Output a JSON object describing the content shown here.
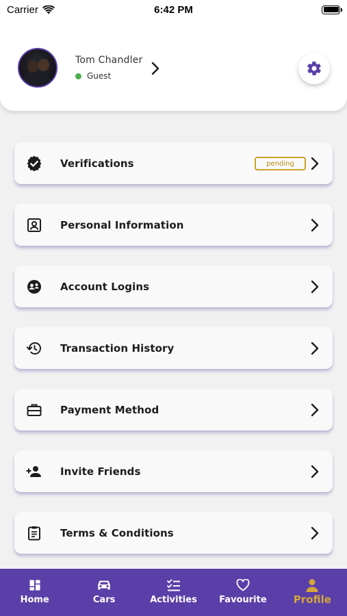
{
  "status_bar": {
    "carrier": "Carrier",
    "time": "6:42 PM"
  },
  "profile": {
    "name": "Tom Chandler",
    "role": "Guest",
    "status_color": "#4caf50"
  },
  "menu": {
    "items": [
      {
        "label": "Verifications",
        "icon": "verified-badge-icon",
        "badge": "pending"
      },
      {
        "label": "Personal Information",
        "icon": "id-card-icon"
      },
      {
        "label": "Account Logins",
        "icon": "logins-icon"
      },
      {
        "label": "Transaction History",
        "icon": "history-icon"
      },
      {
        "label": "Payment Method",
        "icon": "briefcase-icon"
      },
      {
        "label": "Invite Friends",
        "icon": "add-person-icon"
      },
      {
        "label": "Terms & Conditions",
        "icon": "document-list-icon"
      }
    ]
  },
  "bottom_nav": {
    "items": [
      {
        "label": "Home",
        "icon": "dashboard-icon"
      },
      {
        "label": "Cars",
        "icon": "car-icon"
      },
      {
        "label": "Activities",
        "icon": "checklist-icon"
      },
      {
        "label": "Favourite",
        "icon": "heart-icon"
      },
      {
        "label": "Profile",
        "icon": "person-icon",
        "active": true
      }
    ]
  },
  "colors": {
    "accent": "#5b3fa8",
    "active_tab": "#d4a53a",
    "badge": "#c9a227"
  }
}
